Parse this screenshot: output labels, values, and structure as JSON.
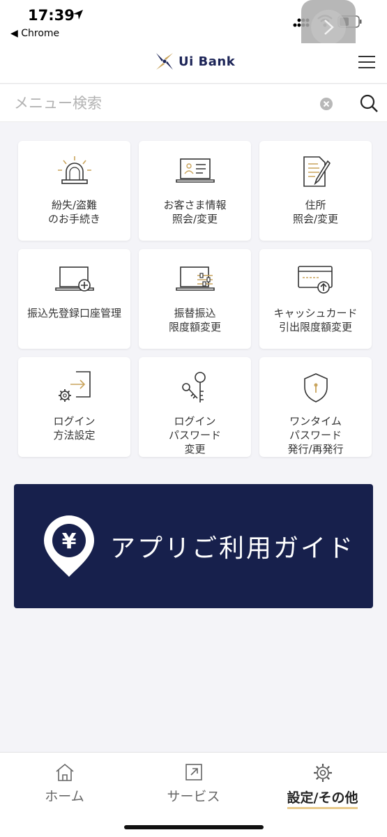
{
  "status_bar": {
    "time": "17:39",
    "back_app": "◀ Chrome"
  },
  "header": {
    "logo_text": "Ui Bank"
  },
  "search": {
    "placeholder": "メニュー検索"
  },
  "menu": [
    {
      "label": "紛失/盗難\nのお手続き",
      "icon": "siren-icon"
    },
    {
      "label": "お客さま情報\n照会/変更",
      "icon": "laptop-profile-icon"
    },
    {
      "label": "住所\n照会/変更",
      "icon": "document-pen-icon"
    },
    {
      "label": "振込先登録口座管理",
      "icon": "laptop-plus-icon"
    },
    {
      "label": "振替振込\n限度額変更",
      "icon": "laptop-slider-icon"
    },
    {
      "label": "キャッシュカード\n引出限度額変更",
      "icon": "card-upload-icon"
    },
    {
      "label": "ログイン\n方法設定",
      "icon": "gear-login-icon"
    },
    {
      "label": "ログイン\nパスワード\n変更",
      "icon": "keys-icon"
    },
    {
      "label": "ワンタイム\nパスワード\n発行/再発行",
      "icon": "shield-icon"
    }
  ],
  "banner": {
    "text": "アプリご利用ガイド",
    "pin_symbol": "¥"
  },
  "bottom_nav": [
    {
      "label": "ホーム",
      "icon": "home-icon",
      "active": false
    },
    {
      "label": "サービス",
      "icon": "external-link-icon",
      "active": false
    },
    {
      "label": "設定/その他",
      "icon": "gear-icon",
      "active": true
    }
  ],
  "colors": {
    "brand_navy": "#17204c",
    "accent_gold": "#c9a45c",
    "background": "#f4f4f8"
  }
}
